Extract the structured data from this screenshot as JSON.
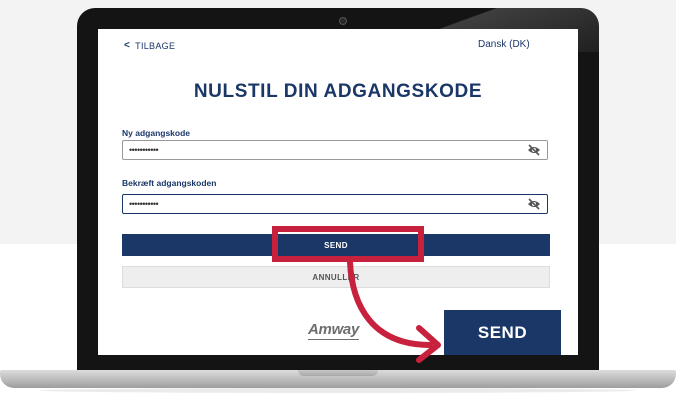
{
  "nav": {
    "back_label": "TILBAGE",
    "language": "Dansk (DK)"
  },
  "page": {
    "title": "NULSTIL DIN ADGANGSKODE"
  },
  "form": {
    "new_password": {
      "label": "Ny adgangskode",
      "value": "•••••••••••"
    },
    "confirm_password": {
      "label": "Bekræft adgangskoden",
      "value": "•••••••••••"
    }
  },
  "buttons": {
    "send": "SEND",
    "cancel": "ANNULLER"
  },
  "brand": {
    "logo": "Amway"
  },
  "callout": {
    "send_label": "SEND"
  },
  "colors": {
    "primary": "#1a3768",
    "highlight": "#c8213e"
  }
}
